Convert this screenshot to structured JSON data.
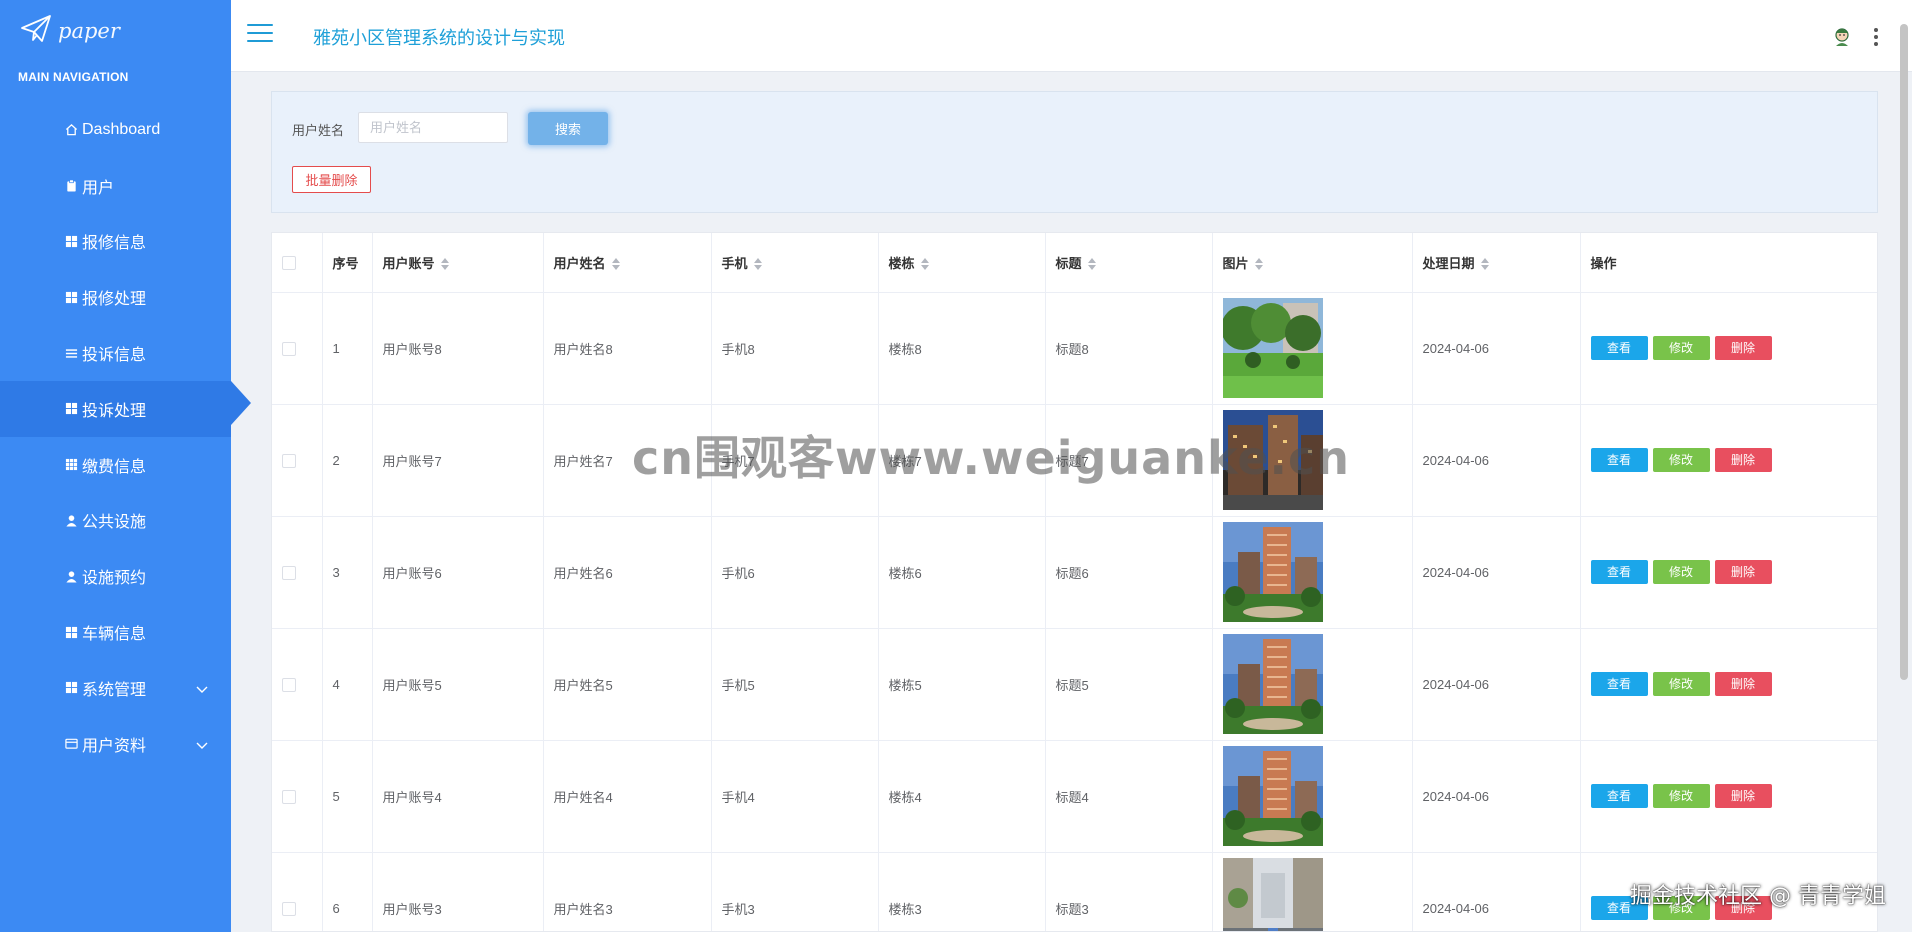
{
  "sidebar": {
    "logo_text": "paper",
    "nav_title": "MAIN NAVIGATION",
    "items": [
      {
        "label": "Dashboard",
        "icon": "home-icon"
      },
      {
        "label": "用户",
        "icon": "clipboard-icon"
      },
      {
        "label": "报修信息",
        "icon": "grid-icon"
      },
      {
        "label": "报修处理",
        "icon": "grid-icon"
      },
      {
        "label": "投诉信息",
        "icon": "list-icon"
      },
      {
        "label": "投诉处理",
        "icon": "grid-icon",
        "active": true
      },
      {
        "label": "缴费信息",
        "icon": "table-grid-icon"
      },
      {
        "label": "公共设施",
        "icon": "user-icon"
      },
      {
        "label": "设施预约",
        "icon": "user-icon"
      },
      {
        "label": "车辆信息",
        "icon": "grid-icon"
      },
      {
        "label": "系统管理",
        "icon": "grid-icon",
        "expandable": true
      },
      {
        "label": "用户资料",
        "icon": "id-card-icon",
        "expandable": true
      }
    ]
  },
  "header": {
    "title": "雅苑小区管理系统的设计与实现"
  },
  "search": {
    "label": "用户姓名",
    "placeholder": "用户姓名",
    "value": "",
    "search_button": "搜索",
    "batch_delete_button": "批量删除"
  },
  "table": {
    "columns": [
      "序号",
      "用户账号",
      "用户姓名",
      "手机",
      "楼栋",
      "标题",
      "图片",
      "处理日期",
      "操作"
    ],
    "actions": {
      "view": "查看",
      "edit": "修改",
      "delete": "删除"
    },
    "rows": [
      {
        "index": "1",
        "account": "用户账号8",
        "name": "用户姓名8",
        "phone": "手机8",
        "building": "楼栋8",
        "title": "标题8",
        "date": "2024-04-06",
        "image": "park-garden-image"
      },
      {
        "index": "2",
        "account": "用户账号7",
        "name": "用户姓名7",
        "phone": "手机7",
        "building": "楼栋7",
        "title": "标题7",
        "date": "2024-04-06",
        "image": "apartment-buildings-dusk-image"
      },
      {
        "index": "3",
        "account": "用户账号6",
        "name": "用户姓名6",
        "phone": "手机6",
        "building": "楼栋6",
        "title": "标题6",
        "date": "2024-04-06",
        "image": "tower-building-garden-image"
      },
      {
        "index": "4",
        "account": "用户账号5",
        "name": "用户姓名5",
        "phone": "手机5",
        "building": "楼栋5",
        "title": "标题5",
        "date": "2024-04-06",
        "image": "tower-building-garden-image"
      },
      {
        "index": "5",
        "account": "用户账号4",
        "name": "用户姓名4",
        "phone": "手机4",
        "building": "楼栋4",
        "title": "标题4",
        "date": "2024-04-06",
        "image": "tower-building-garden-image"
      },
      {
        "index": "6",
        "account": "用户账号3",
        "name": "用户姓名3",
        "phone": "手机3",
        "building": "楼栋3",
        "title": "标题3",
        "date": "2024-04-06",
        "image": "street-parking-image"
      }
    ]
  },
  "overlays": {
    "watermark": "cn围观客www.weiguanke.cn",
    "corner_watermark": "掘金技术社区 @ 青青学姐"
  },
  "colors": {
    "sidebar_bg": "#3c8af3",
    "sidebar_active": "#2f7ae6",
    "title_color": "#1fa0d8",
    "view_button": "#1ba6ea",
    "edit_button": "#79c34a",
    "delete_button": "#e84f5f"
  }
}
